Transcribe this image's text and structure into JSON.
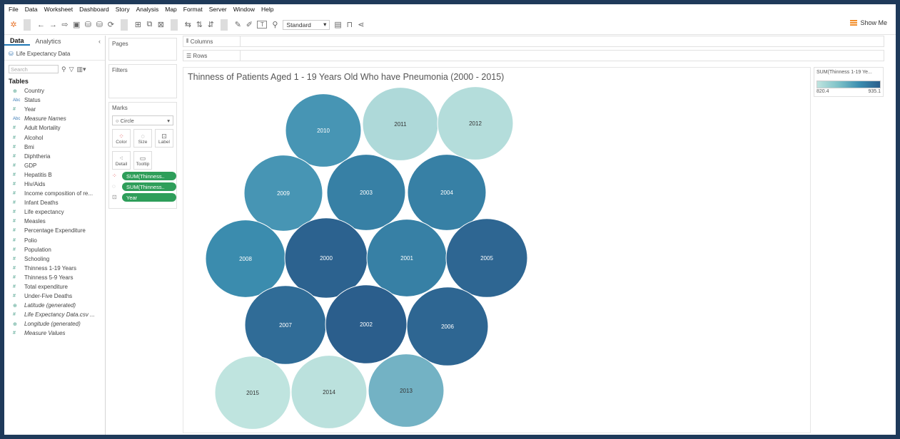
{
  "menu": [
    "File",
    "Data",
    "Worksheet",
    "Dashboard",
    "Story",
    "Analysis",
    "Map",
    "Format",
    "Server",
    "Window",
    "Help"
  ],
  "toolbar": {
    "standard": "Standard",
    "show_me": "Show Me"
  },
  "data_pane": {
    "tab_data": "Data",
    "tab_analytics": "Analytics",
    "source": "Life Expectancy Data",
    "search_placeholder": "Search",
    "tables_label": "Tables",
    "fields": [
      {
        "name": "Country",
        "type": "geo"
      },
      {
        "name": "Status",
        "type": "abc"
      },
      {
        "name": "Year",
        "type": "num"
      },
      {
        "name": "Measure Names",
        "type": "abc",
        "italic": true
      },
      {
        "name": "Adult Mortality",
        "type": "num"
      },
      {
        "name": "Alcohol",
        "type": "num"
      },
      {
        "name": "Bmi",
        "type": "num"
      },
      {
        "name": "Diphtheria",
        "type": "num"
      },
      {
        "name": "GDP",
        "type": "num"
      },
      {
        "name": "Hepatitis B",
        "type": "num"
      },
      {
        "name": "Hiv/Aids",
        "type": "num"
      },
      {
        "name": "Income composition of re...",
        "type": "num"
      },
      {
        "name": "Infant Deaths",
        "type": "num"
      },
      {
        "name": "Life expectancy",
        "type": "num"
      },
      {
        "name": "Measles",
        "type": "num"
      },
      {
        "name": "Percentage Expenditure",
        "type": "num"
      },
      {
        "name": "Polio",
        "type": "num"
      },
      {
        "name": "Population",
        "type": "num"
      },
      {
        "name": "Schooling",
        "type": "num"
      },
      {
        "name": "Thinness 1-19 Years",
        "type": "num"
      },
      {
        "name": "Thinness 5-9 Years",
        "type": "num"
      },
      {
        "name": "Total expenditure",
        "type": "num"
      },
      {
        "name": "Under-Five Deaths",
        "type": "num"
      },
      {
        "name": "Latitude (generated)",
        "type": "geo",
        "italic": true
      },
      {
        "name": "Life Expectancy Data.csv ...",
        "type": "num",
        "italic": true
      },
      {
        "name": "Longitude (generated)",
        "type": "geo",
        "italic": true
      },
      {
        "name": "Measure Values",
        "type": "num",
        "italic": true
      }
    ]
  },
  "cards": {
    "pages": "Pages",
    "filters": "Filters",
    "marks": "Marks",
    "mark_type": "Circle",
    "buttons": [
      "Color",
      "Size",
      "Label",
      "Detail",
      "Tooltip"
    ],
    "pills": [
      "SUM(Thinness..",
      "SUM(Thinness..",
      "Year"
    ]
  },
  "shelves": {
    "columns": "Columns",
    "rows": "Rows"
  },
  "legend": {
    "title": "SUM(Thinness 1-19 Ye...",
    "min": "820.4",
    "max": "935.1"
  },
  "chart_data": {
    "type": "packed-bubble",
    "title": "Thinness of Patients Aged 1 - 19 Years Old Who have Pneumonia (2000 - 2015)",
    "measure": "SUM(Thinness 1-19 Years)",
    "color_range": [
      820.4,
      935.1
    ],
    "colors": {
      "low": "#bfe4df",
      "mid": "#3c8eb0",
      "high": "#2b5e8c"
    },
    "bubbles": [
      {
        "year": "2010",
        "level": 0.55
      },
      {
        "year": "2011",
        "level": 0.08
      },
      {
        "year": "2012",
        "level": 0.05
      },
      {
        "year": "2009",
        "level": 0.55
      },
      {
        "year": "2003",
        "level": 0.72
      },
      {
        "year": "2004",
        "level": 0.72
      },
      {
        "year": "2008",
        "level": 0.62
      },
      {
        "year": "2000",
        "level": 0.97
      },
      {
        "year": "2001",
        "level": 0.72
      },
      {
        "year": "2005",
        "level": 0.93
      },
      {
        "year": "2007",
        "level": 0.88
      },
      {
        "year": "2002",
        "level": 1.0
      },
      {
        "year": "2006",
        "level": 0.93
      },
      {
        "year": "2015",
        "level": 0.0
      },
      {
        "year": "2014",
        "level": 0.02
      },
      {
        "year": "2013",
        "level": 0.35
      }
    ]
  }
}
